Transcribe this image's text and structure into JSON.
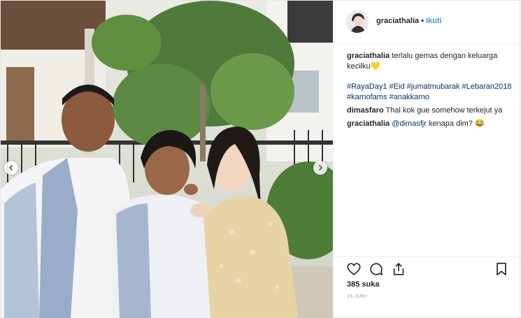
{
  "header": {
    "username": "graciathalia",
    "separator": "•",
    "follow_label": "Ikuti"
  },
  "caption": {
    "username": "graciathalia",
    "text": "terlalu gemas dengan keluarga kecilku",
    "emoji": "💛",
    "hashtags": [
      "#RayaDay1",
      "#Eid",
      "#jumatmubarak",
      "#Lebaran2018",
      "#karnofams",
      "#anakkarno"
    ]
  },
  "comments": [
    {
      "username": "dimasfaro",
      "text": "Thal kok gue somehow terkejut ya"
    },
    {
      "username": "graciathalia",
      "mention": "@dimasfjr",
      "text": "kenapa dim?",
      "emoji": "😂"
    }
  ],
  "actions": {
    "icons": [
      "heart-icon",
      "comment-icon",
      "share-icon",
      "bookmark-icon"
    ]
  },
  "likes": {
    "text": "385 suka"
  },
  "date": {
    "text": "16 JUNI"
  },
  "carousel": {
    "prev_icon": "chevron-left-icon",
    "next_icon": "chevron-right-icon"
  },
  "colors": {
    "link": "#003569",
    "follow": "#3897f0",
    "text": "#262626",
    "muted": "#999999",
    "border": "#efefef"
  }
}
